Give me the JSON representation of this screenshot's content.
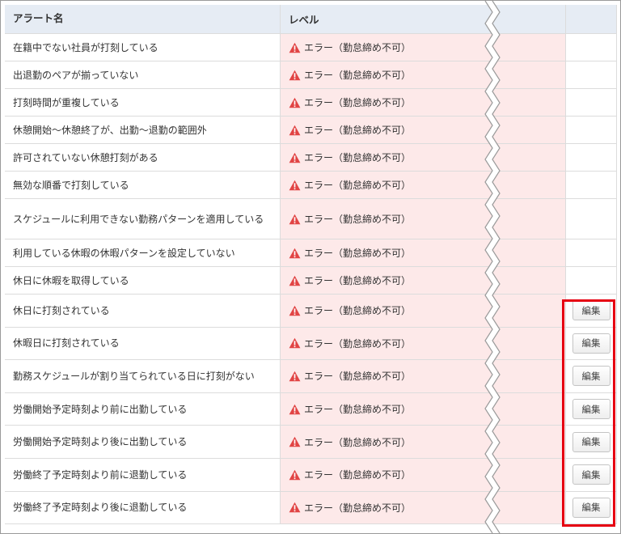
{
  "table": {
    "headers": {
      "name": "アラート名",
      "level": "レベル",
      "action": ""
    },
    "level_text": "エラー（勤怠締め不可）",
    "edit_label": "編集",
    "warning_color": "#e14444",
    "rows": [
      {
        "name": "在籍中でない社員が打刻している",
        "editable": false
      },
      {
        "name": "出退勤のペアが揃っていない",
        "editable": false
      },
      {
        "name": "打刻時間が重複している",
        "editable": false
      },
      {
        "name": "休憩開始～休憩終了が、出勤～退勤の範囲外",
        "editable": false
      },
      {
        "name": "許可されていない休憩打刻がある",
        "editable": false
      },
      {
        "name": "無効な順番で打刻している",
        "editable": false
      },
      {
        "name": "スケジュールに利用できない勤務パターンを適用している",
        "editable": false
      },
      {
        "name": "利用している休暇の休暇パターンを設定していない",
        "editable": false
      },
      {
        "name": "休日に休暇を取得している",
        "editable": false
      },
      {
        "name": "休日に打刻されている",
        "editable": true
      },
      {
        "name": "休暇日に打刻されている",
        "editable": true
      },
      {
        "name": "勤務スケジュールが割り当てられている日に打刻がない",
        "editable": true
      },
      {
        "name": "労働開始予定時刻より前に出勤している",
        "editable": true
      },
      {
        "name": "労働開始予定時刻より後に出勤している",
        "editable": true
      },
      {
        "name": "労働終了予定時刻より前に退勤している",
        "editable": true
      },
      {
        "name": "労働終了予定時刻より後に退勤している",
        "editable": true
      }
    ]
  },
  "annotation": {
    "highlight_color": "#e60012"
  }
}
